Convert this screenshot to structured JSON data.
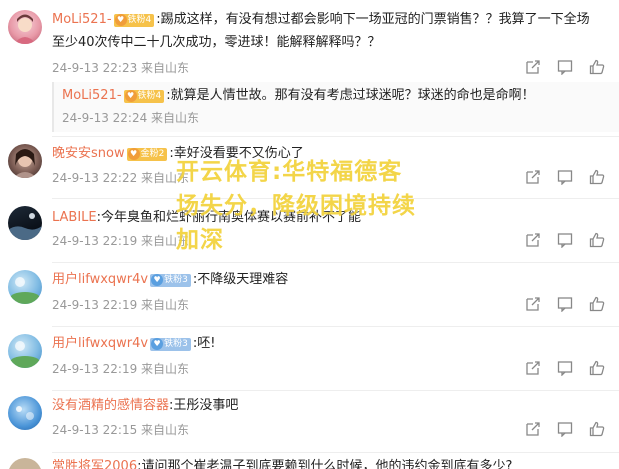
{
  "comments": [
    {
      "user": "MoLi521-",
      "badge": "铁粉4",
      "text_line1": ":踢成这样，有没有想过都会影响下一场亚冠的门票销售？？我算了一下全场",
      "text_line2": "至少40次传中二十几次成功，零进球！能解释解释吗？？",
      "meta": "24-9-13 22:23 来自山东"
    },
    {
      "user": "MoLi521-",
      "badge": "铁粉4",
      "text_line1": ":就算是人情世故。那有没有考虑过球迷呢？球迷的命也是命啊！",
      "meta": "24-9-13 22:24 来自山东"
    },
    {
      "user": "晚安安snow",
      "badge": "金粉2",
      "text_line1": ":幸好没看要不又伤心了",
      "meta": "24-9-13 22:22 来自山东"
    },
    {
      "user": "LABILE",
      "text_line1": ":今年臭鱼和烂虾丽行南奥体赛以赛前补不了能",
      "meta": "24-9-13 22:19 来自山东"
    },
    {
      "user": "用户lifwxqwr4v",
      "badge": "铁粉3",
      "text_line1": ":不降级天理难容",
      "meta": "24-9-13 22:19 来自山东"
    },
    {
      "user": "用户lifwxqwr4v",
      "badge": "铁粉3",
      "text_line1": ":呸!",
      "meta": "24-9-13 22:19 来自山东"
    },
    {
      "user": "没有酒精的感情容器",
      "text_line1": ":王彤没事吧",
      "meta": "24-9-13 22:15 来自山东"
    },
    {
      "user": "常胜将军2006",
      "text_line1": ":请问那个崔老温子到底要赖到什么时候，他的违约金到底有多少?"
    }
  ],
  "watermark": {
    "line1": "开云体育:华特福德客",
    "line2": "场失分，降级困境持续",
    "line3": "加深"
  },
  "icons": {
    "share": "share-icon",
    "comment": "comment-icon",
    "like": "like-icon"
  },
  "colors": {
    "username": "#eb7350",
    "meta": "#999999",
    "watermark": "#f2d23a"
  }
}
